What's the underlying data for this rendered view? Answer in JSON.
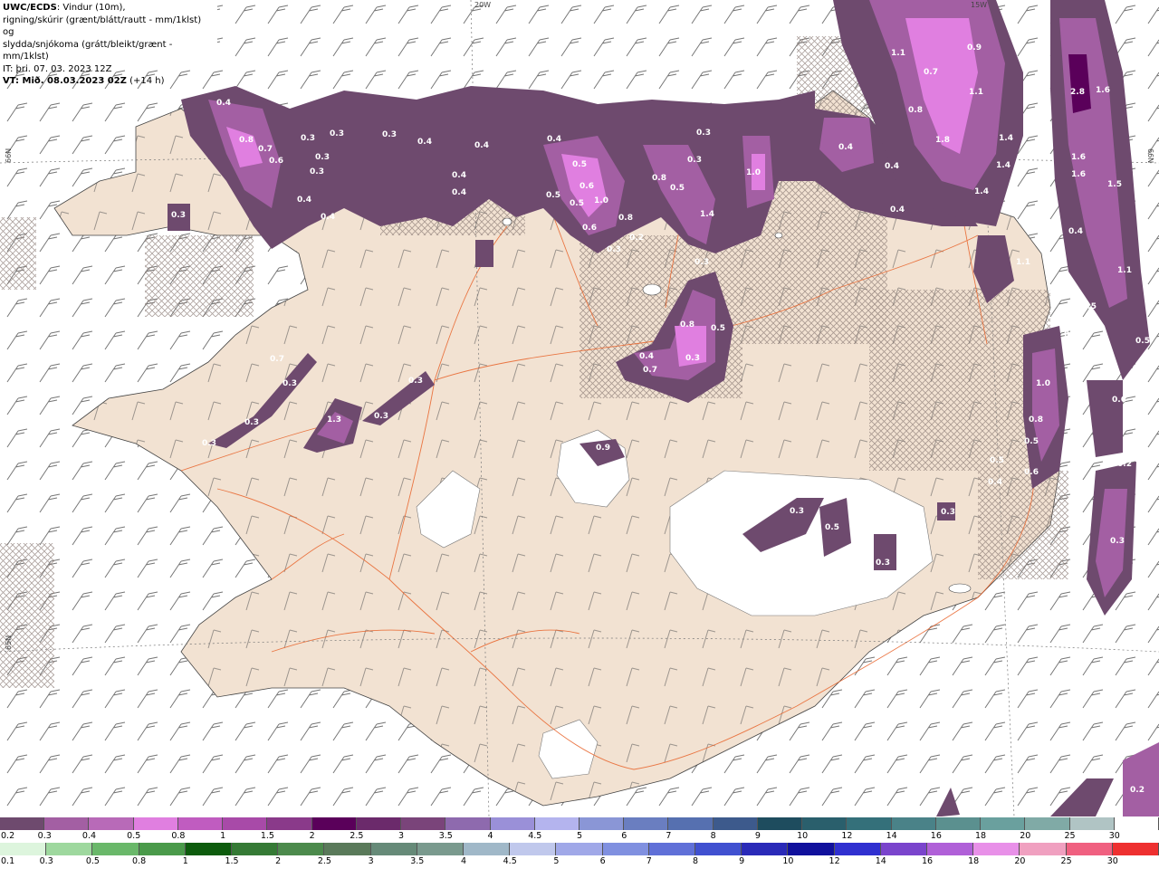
{
  "header": {
    "line1_bold": "UWC/ECDS",
    "line1_rest": ": Vindur (10m),",
    "line2": "rigning/skúrir (grænt/blátt/rautt - mm/1klst) og",
    "line3": "slydda/snjókoma (grátt/bleikt/grænt - mm/1klst)",
    "line4": "IT: þri. 07. 03. 2023 12Z",
    "line5_bold": "VT: Mið. 08.03.2023 02Z",
    "line5_rest": " (+14 h)"
  },
  "map_labels": {
    "lon_top_1": "20W",
    "lon_top_2": "15W",
    "lat_left_1": "66N",
    "lat_left_2": "65N",
    "lat_right_1": "66N"
  },
  "precip_values": [
    {
      "text": "0.4"
    },
    {
      "text": "0.8"
    },
    {
      "text": "0.7"
    },
    {
      "text": "0.6"
    },
    {
      "text": "0.3"
    },
    {
      "text": "0.3"
    },
    {
      "text": "0.3"
    },
    {
      "text": "0.3"
    },
    {
      "text": "0.4"
    },
    {
      "text": "0.3"
    },
    {
      "text": "0.3"
    },
    {
      "text": "0.4"
    },
    {
      "text": "0.4"
    },
    {
      "text": "0.4"
    },
    {
      "text": "0.4"
    },
    {
      "text": "0.4"
    },
    {
      "text": "0.5"
    },
    {
      "text": "0.4"
    },
    {
      "text": "0.5"
    },
    {
      "text": "0.6"
    },
    {
      "text": "1.0"
    },
    {
      "text": "0.8"
    },
    {
      "text": "0.5"
    },
    {
      "text": "0.5"
    },
    {
      "text": "0.2"
    },
    {
      "text": "0.3"
    },
    {
      "text": "0.6"
    },
    {
      "text": "0.8"
    },
    {
      "text": "1.4"
    },
    {
      "text": "0.3"
    },
    {
      "text": "1.0"
    },
    {
      "text": "0.3"
    },
    {
      "text": "0.3"
    },
    {
      "text": "0.4"
    },
    {
      "text": "0.4"
    },
    {
      "text": "0.4"
    },
    {
      "text": "1.1"
    },
    {
      "text": "0.9"
    },
    {
      "text": "0.7"
    },
    {
      "text": "1.1"
    },
    {
      "text": "0.8"
    },
    {
      "text": "1.8"
    },
    {
      "text": "1.4"
    },
    {
      "text": "1.4"
    },
    {
      "text": "1.6"
    },
    {
      "text": "1.4"
    },
    {
      "text": "2.8"
    },
    {
      "text": "1.6"
    },
    {
      "text": "1.6"
    },
    {
      "text": "1.5"
    },
    {
      "text": "0.4"
    },
    {
      "text": "1.1"
    },
    {
      "text": "1.1"
    },
    {
      "text": "0.5"
    },
    {
      "text": "0.3"
    },
    {
      "text": "1.4"
    },
    {
      "text": "0.5"
    },
    {
      "text": "1.0"
    },
    {
      "text": "0.6"
    },
    {
      "text": "0.8"
    },
    {
      "text": "0.7"
    },
    {
      "text": "0.4"
    },
    {
      "text": "0.3"
    },
    {
      "text": "0.5"
    },
    {
      "text": "0.8"
    },
    {
      "text": "0.5"
    },
    {
      "text": "0.6"
    },
    {
      "text": "0.5"
    },
    {
      "text": "0.2"
    },
    {
      "text": "0.4"
    },
    {
      "text": "0.3"
    },
    {
      "text": "0.5"
    },
    {
      "text": "0.3"
    },
    {
      "text": "0.3"
    },
    {
      "text": "0.3"
    },
    {
      "text": "0.9"
    },
    {
      "text": "0.3"
    },
    {
      "text": "0.3"
    },
    {
      "text": "1.3"
    },
    {
      "text": "0.3"
    },
    {
      "text": "0.3"
    },
    {
      "text": "0.3"
    },
    {
      "text": "0.7"
    },
    {
      "text": "0.2"
    }
  ],
  "legend_snow": {
    "labels": [
      "0.2",
      "0.3",
      "0.4",
      "0.5",
      "0.8",
      "1",
      "1.5",
      "2",
      "2.5",
      "3",
      "3.5",
      "4",
      "4.5",
      "5",
      "6",
      "7",
      "8",
      "9",
      "10",
      "12",
      "14",
      "16",
      "18",
      "20",
      "25",
      "30"
    ],
    "colors": [
      "#6e4a6e",
      "#a35fa3",
      "#b86ab8",
      "#e07fe0",
      "#c05cc0",
      "#a84aa8",
      "#8a3a8a",
      "#5a005a",
      "#6b2a6b",
      "#7a447a",
      "#8e6aae",
      "#9a90d8",
      "#b4b4ee",
      "#8a96d6",
      "#6a7ec0",
      "#5670b0",
      "#3d5a8c",
      "#1e4c5e",
      "#2a5f6c",
      "#34707a",
      "#4a8288",
      "#5b908f",
      "#6aa09e",
      "#80aaa6",
      "#b0c4c4",
      "#ffffff"
    ]
  },
  "legend_rain": {
    "labels": [
      "0.1",
      "0.3",
      "0.5",
      "0.8",
      "1",
      "1.5",
      "2",
      "2.5",
      "3",
      "3.5",
      "4",
      "4.5",
      "5",
      "6",
      "7",
      "8",
      "9",
      "10",
      "12",
      "14",
      "16",
      "18",
      "20",
      "25",
      "30"
    ],
    "colors": [
      "#ddf5dd",
      "#9ed89e",
      "#6ab86a",
      "#4a9a4a",
      "#0d5c0d",
      "#357a35",
      "#4c8a4c",
      "#5a7a5a",
      "#668a78",
      "#7a9a8e",
      "#a0b8c8",
      "#c0c8ec",
      "#a0a8e8",
      "#8090e0",
      "#6070d8",
      "#4050d0",
      "#2a2ab8",
      "#10109c",
      "#3030d0",
      "#7a44cc",
      "#b060d8",
      "#e890e8",
      "#f0a0c0",
      "#f06080",
      "#ee3030"
    ]
  },
  "colors": {
    "sea": "#ffffff",
    "land": "#f2e2d2",
    "roads": "#e8632a",
    "snow_light": "#6e4a6e",
    "snow_mid": "#a35fa3",
    "snow_heavy": "#e07fe0"
  }
}
